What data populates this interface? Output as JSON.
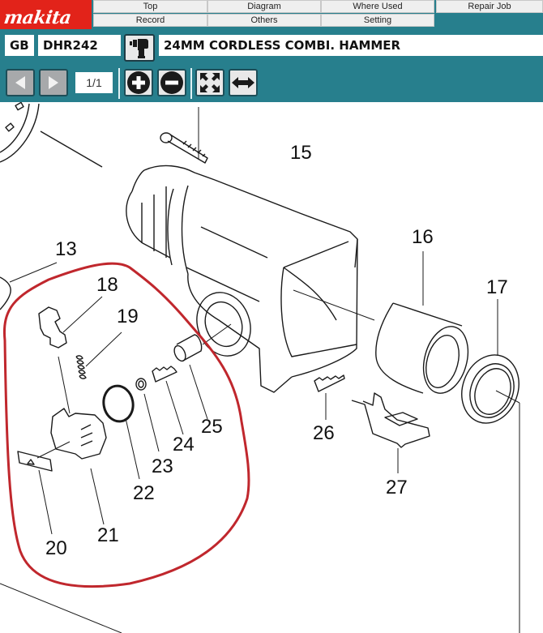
{
  "brand": {
    "logo_text": "makita",
    "color": "#e2231a"
  },
  "nav": {
    "row1": [
      "Top",
      "Diagram",
      "Where Used",
      "Repair Job"
    ],
    "row2": [
      "Record",
      "Others",
      "Setting"
    ]
  },
  "model": {
    "region": "GB",
    "model_number": "DHR242",
    "tool_icon": "hammer-drill-icon",
    "description": "24MM CORDLESS COMBI. HAMMER"
  },
  "toolbar": {
    "prev_icon": "prev-arrow-icon",
    "next_icon": "next-arrow-icon",
    "page_indicator": "1/1",
    "zoom_in_icon": "zoom-in-icon",
    "zoom_out_icon": "zoom-out-icon",
    "fit_icon": "fit-screen-icon",
    "fit_width_icon": "fit-width-icon"
  },
  "colors": {
    "header_teal": "#277f8d",
    "highlight_circle": "#c0272d"
  },
  "diagram": {
    "callouts": [
      "13",
      "15",
      "16",
      "17",
      "18",
      "19",
      "20",
      "21",
      "22",
      "23",
      "24",
      "25",
      "26",
      "27"
    ],
    "highlighted_parts": [
      "18",
      "19",
      "20",
      "21",
      "22",
      "23",
      "24",
      "25"
    ]
  }
}
